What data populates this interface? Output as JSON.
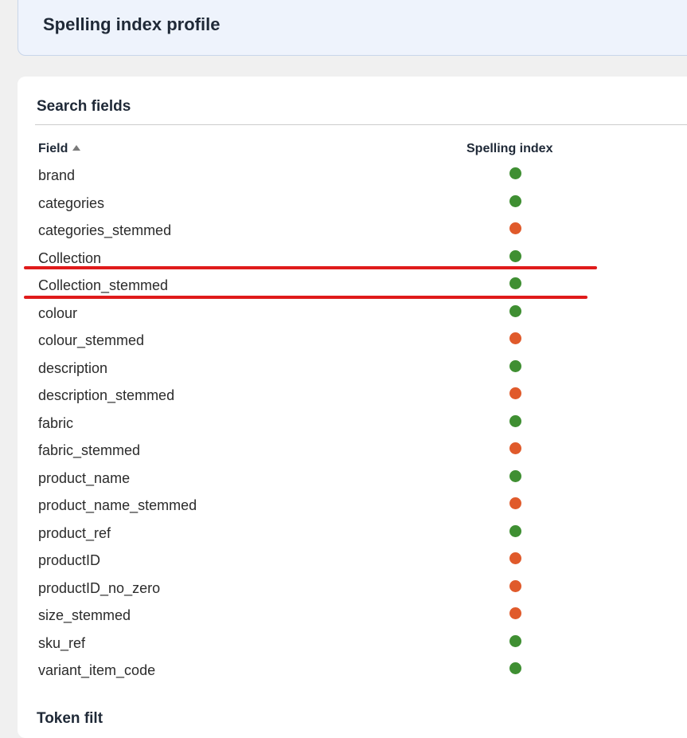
{
  "header": {
    "title": "Spelling index profile"
  },
  "section": {
    "title": "Search fields",
    "next_section_title_partial": "Token filt"
  },
  "table": {
    "columns": {
      "field": "Field",
      "spelling_index": "Spelling index"
    },
    "sort": {
      "column": "Field",
      "direction": "ascending",
      "icon": "sort-ascending-icon"
    },
    "status_colors": {
      "enabled": "#3f8f32",
      "disabled": "#e05a2b"
    },
    "rows": [
      {
        "field": "brand",
        "spelling_index": "enabled"
      },
      {
        "field": "categories",
        "spelling_index": "enabled"
      },
      {
        "field": "categories_stemmed",
        "spelling_index": "disabled"
      },
      {
        "field": "Collection",
        "spelling_index": "enabled"
      },
      {
        "field": "Collection_stemmed",
        "spelling_index": "enabled"
      },
      {
        "field": "colour",
        "spelling_index": "enabled"
      },
      {
        "field": "colour_stemmed",
        "spelling_index": "disabled"
      },
      {
        "field": "description",
        "spelling_index": "enabled"
      },
      {
        "field": "description_stemmed",
        "spelling_index": "disabled"
      },
      {
        "field": "fabric",
        "spelling_index": "enabled"
      },
      {
        "field": "fabric_stemmed",
        "spelling_index": "disabled"
      },
      {
        "field": "product_name",
        "spelling_index": "enabled"
      },
      {
        "field": "product_name_stemmed",
        "spelling_index": "disabled"
      },
      {
        "field": "product_ref",
        "spelling_index": "enabled"
      },
      {
        "field": "productID",
        "spelling_index": "disabled"
      },
      {
        "field": "productID_no_zero",
        "spelling_index": "disabled"
      },
      {
        "field": "size_stemmed",
        "spelling_index": "disabled"
      },
      {
        "field": "sku_ref",
        "spelling_index": "enabled"
      },
      {
        "field": "variant_item_code",
        "spelling_index": "enabled"
      }
    ]
  },
  "annotations": {
    "highlight_color": "#e01b1b",
    "underlined_fields": [
      "Collection",
      "Collection_stemmed"
    ]
  }
}
